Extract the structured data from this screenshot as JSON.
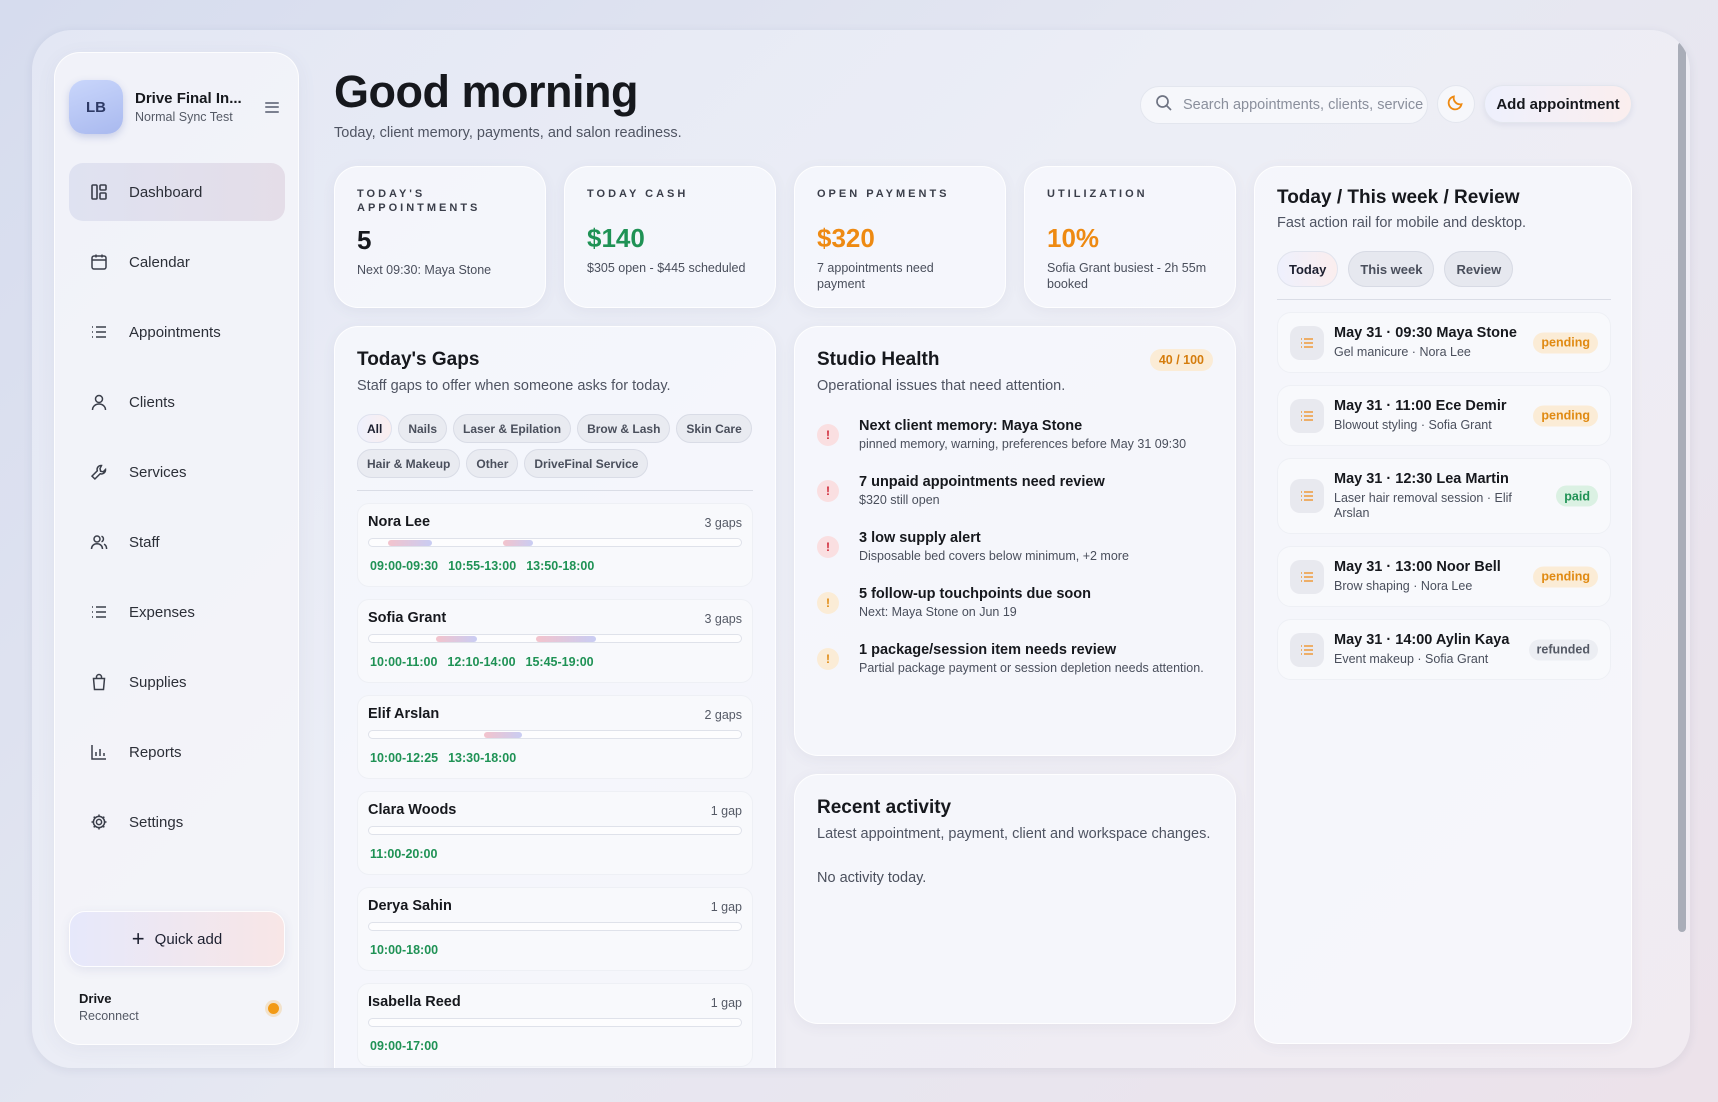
{
  "workspace": {
    "initials": "LB",
    "title": "Drive Final In...",
    "subtitle": "Normal Sync Test"
  },
  "nav": [
    {
      "label": "Dashboard",
      "icon": "dashboard-icon",
      "active": true
    },
    {
      "label": "Calendar",
      "icon": "calendar-icon"
    },
    {
      "label": "Appointments",
      "icon": "list-icon"
    },
    {
      "label": "Clients",
      "icon": "user-icon"
    },
    {
      "label": "Services",
      "icon": "wrench-icon"
    },
    {
      "label": "Staff",
      "icon": "users-icon"
    },
    {
      "label": "Expenses",
      "icon": "list-icon"
    },
    {
      "label": "Supplies",
      "icon": "bag-icon"
    },
    {
      "label": "Reports",
      "icon": "bar-chart-icon"
    },
    {
      "label": "Settings",
      "icon": "gear-icon"
    }
  ],
  "quick_add": "Quick add",
  "drive": {
    "title": "Drive",
    "subtitle": "Reconnect",
    "status_color": "#f29a15"
  },
  "header": {
    "greeting": "Good morning",
    "subtitle": "Today, client memory, payments, and salon readiness.",
    "search_placeholder": "Search appointments, clients, services",
    "add_label": "Add appointment"
  },
  "stats": [
    {
      "label": "Today's appointments",
      "value": "5",
      "note": "Next 09:30: Maya Stone"
    },
    {
      "label": "Today cash",
      "value": "$140",
      "note": "$305 open - $445 scheduled",
      "color": "#1f9255"
    },
    {
      "label": "Open payments",
      "value": "$320",
      "note": "7 appointments need payment",
      "color": "#ee8a12"
    },
    {
      "label": "Utilization",
      "value": "10%",
      "note": "Sofia Grant busiest - 2h 55m booked",
      "color": "#ee8a12"
    }
  ],
  "gaps": {
    "title": "Today's Gaps",
    "subtitle": "Staff gaps to offer when someone asks for today.",
    "filters": [
      "All",
      "Nails",
      "Laser & Epilation",
      "Brow & Lash",
      "Skin Care",
      "Hair & Makeup",
      "Other",
      "DriveFinal Service"
    ],
    "active_filter": "All",
    "staff": [
      {
        "name": "Nora Lee",
        "count": "3 gaps",
        "times": [
          "09:00-09:30",
          "10:55-13:00",
          "13:50-18:00"
        ],
        "booked": [
          [
            0.05,
            0.17
          ],
          [
            0.36,
            0.44
          ]
        ]
      },
      {
        "name": "Sofia Grant",
        "count": "3 gaps",
        "times": [
          "10:00-11:00",
          "12:10-14:00",
          "15:45-19:00"
        ],
        "booked": [
          [
            0.18,
            0.29
          ],
          [
            0.45,
            0.61
          ]
        ]
      },
      {
        "name": "Elif Arslan",
        "count": "2 gaps",
        "times": [
          "10:00-12:25",
          "13:30-18:00"
        ],
        "booked": [
          [
            0.31,
            0.41
          ]
        ]
      },
      {
        "name": "Clara Woods",
        "count": "1 gap",
        "times": [
          "11:00-20:00"
        ],
        "booked": []
      },
      {
        "name": "Derya Sahin",
        "count": "1 gap",
        "times": [
          "10:00-18:00"
        ],
        "booked": []
      },
      {
        "name": "Isabella Reed",
        "count": "1 gap",
        "times": [
          "09:00-17:00"
        ],
        "booked": []
      }
    ]
  },
  "health": {
    "title": "Studio Health",
    "subtitle": "Operational issues that need attention.",
    "score": "40 / 100",
    "issues": [
      {
        "level": "red",
        "title": "Next client memory: Maya Stone",
        "sub": "pinned memory, warning, preferences before May 31 09:30"
      },
      {
        "level": "red",
        "title": "7 unpaid appointments need review",
        "sub": "$320 still open"
      },
      {
        "level": "red",
        "title": "3 low supply alert",
        "sub": "Disposable bed covers below minimum, +2 more"
      },
      {
        "level": "amber",
        "title": "5 follow-up touchpoints due soon",
        "sub": "Next: Maya Stone on Jun 19"
      },
      {
        "level": "amber",
        "title": "1 package/session item needs review",
        "sub": "Partial package payment or session depletion needs attention."
      }
    ]
  },
  "activity": {
    "title": "Recent activity",
    "subtitle": "Latest appointment, payment, client and workspace changes.",
    "empty": "No activity today."
  },
  "rail": {
    "title": "Today / This week / Review",
    "subtitle": "Fast action rail for mobile and desktop.",
    "tabs": [
      "Today",
      "This week",
      "Review"
    ],
    "active_tab": "Today",
    "appointments": [
      {
        "title": "May 31 · 09:30 Maya Stone",
        "sub": "Gel manicure · Nora Lee",
        "status": "pending"
      },
      {
        "title": "May 31 · 11:00 Ece Demir",
        "sub": "Blowout styling · Sofia Grant",
        "status": "pending"
      },
      {
        "title": "May 31 · 12:30 Lea Martin",
        "sub": "Laser hair removal session · Elif Arslan",
        "status": "paid"
      },
      {
        "title": "May 31 · 13:00 Noor Bell",
        "sub": "Brow shaping · Nora Lee",
        "status": "pending"
      },
      {
        "title": "May 31 · 14:00 Aylin Kaya",
        "sub": "Event makeup · Sofia Grant",
        "status": "refunded"
      }
    ]
  }
}
